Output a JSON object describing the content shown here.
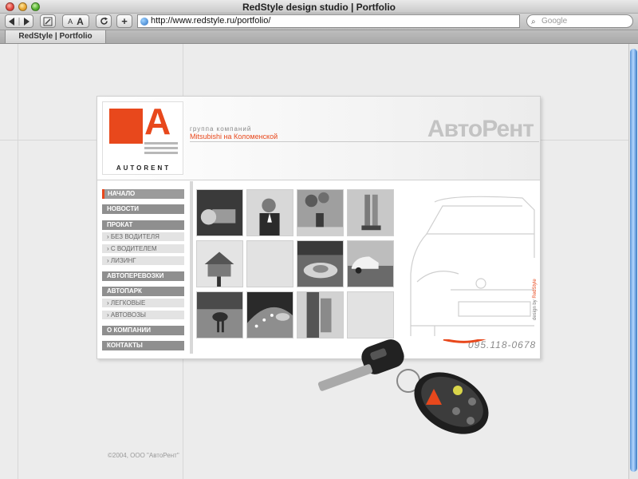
{
  "window": {
    "title": "RedStyle design studio | Portfolio"
  },
  "toolbar": {
    "back_icon": "back-arrow-icon",
    "forward_icon": "forward-arrow-icon",
    "text_small": "A",
    "text_large": "A",
    "reload_icon": "reload-icon",
    "add_label": "+",
    "url": "http://www.redstyle.ru/portfolio/",
    "search_placeholder": "Google"
  },
  "tabs": [
    {
      "label": "RedStyle | Portfolio"
    }
  ],
  "site": {
    "logo_word": "AUTORENT",
    "logo_letter": "A",
    "group_label": "группа компаний",
    "group_name": "Mitsubishi на Коломенской",
    "brand": "АвтоРент",
    "nav": [
      {
        "label": "НАЧАЛО",
        "type": "main",
        "active": true
      },
      {
        "label": "НОВОСТИ",
        "type": "main"
      },
      {
        "label": "ПРОКАТ",
        "type": "main"
      },
      {
        "label": "› БЕЗ ВОДИТЕЛЯ",
        "type": "sub"
      },
      {
        "label": "› С ВОДИТЕЛЕМ",
        "type": "sub"
      },
      {
        "label": "› ЛИЗИНГ",
        "type": "sub"
      },
      {
        "label": "АВТОПЕРЕВОЗКИ",
        "type": "main"
      },
      {
        "label": "АВТОПАРК",
        "type": "main"
      },
      {
        "label": "› ЛЕГКОВЫЕ",
        "type": "sub"
      },
      {
        "label": "› АВТОВОЗЫ",
        "type": "sub"
      },
      {
        "label": "О КОМПАНИИ",
        "type": "main"
      },
      {
        "label": "КОНТАКТЫ",
        "type": "main"
      }
    ],
    "phone": "095.118-0678",
    "design_by_prefix": "design by",
    "design_by_name": "RedStyle",
    "copyright": "©2004, ООО \"АвтоРент\""
  },
  "colors": {
    "accent": "#e8481c",
    "nav_gray": "#8f8f8f",
    "scroll_blue": "#5b95d6"
  }
}
